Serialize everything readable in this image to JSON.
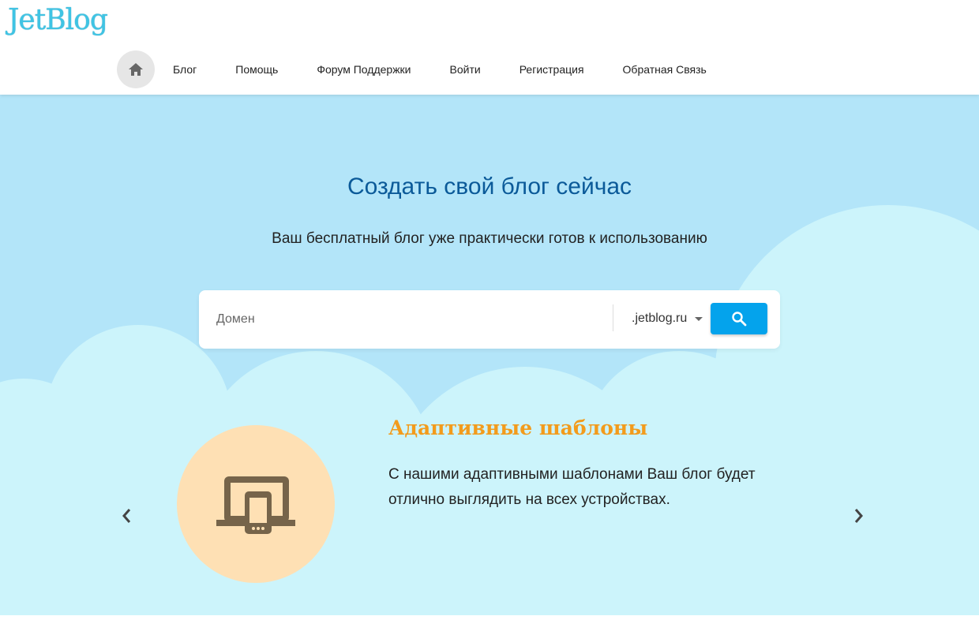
{
  "header": {
    "logo": "JetBlog",
    "nav": [
      "Блог",
      "Помощь",
      "Форум Поддержки",
      "Войти",
      "Регистрация",
      "Обратная Связь"
    ],
    "home_icon": "home-icon"
  },
  "hero": {
    "title": "Создать свой блог сейчас",
    "subtitle": "Ваш бесплатный блог уже практически готов к использованию"
  },
  "search": {
    "placeholder": "Домен",
    "value": "",
    "zone": ".jetblog.ru",
    "button_icon": "search-icon"
  },
  "feature": {
    "title": "Адаптивные шаблоны",
    "text": "С нашими адаптивными шаблонами Ваш блог будет отлично выглядить на всех устройствах.",
    "icon": "devices-icon"
  },
  "carousel": {
    "prev_icon": "chevron-left-icon",
    "next_icon": "chevron-right-icon"
  },
  "colors": {
    "hero_bg": "#b3e5f9",
    "cloud": "#ccf4fb",
    "title": "#0b5a99",
    "accent_button": "#04a3ec",
    "feature_title": "#f29b1c",
    "feature_circle": "#fee0b4",
    "icon_brown": "#76644a"
  }
}
